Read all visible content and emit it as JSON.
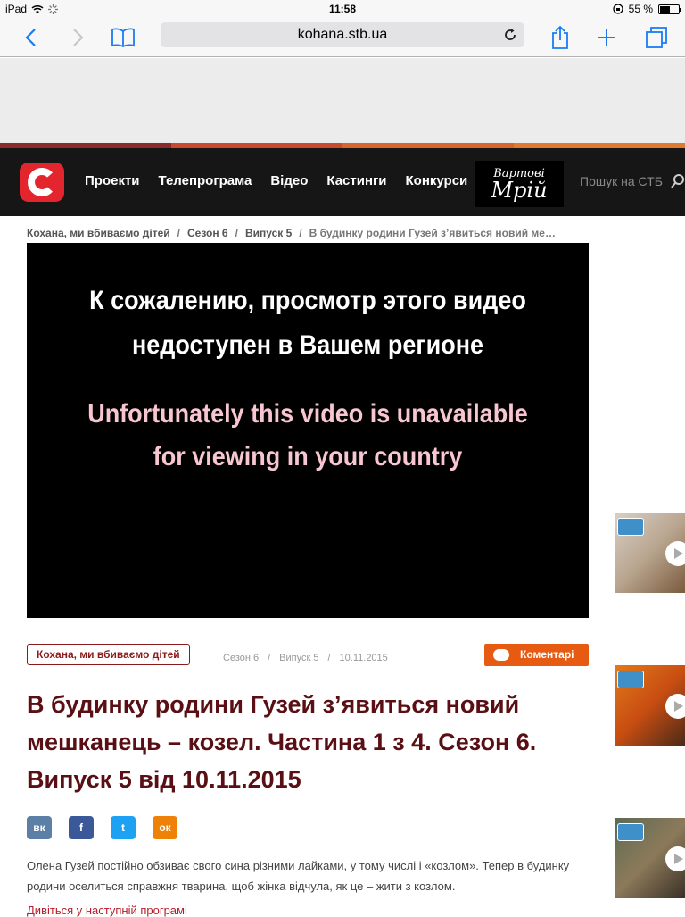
{
  "status_bar": {
    "device": "iPad",
    "time": "11:58",
    "battery": "55 %",
    "battery_level": 0.55
  },
  "browser": {
    "url": "kohana.stb.ua"
  },
  "site_nav": {
    "items": [
      "Проекти",
      "Телепрограма",
      "Відео",
      "Кастинги",
      "Конкурси"
    ],
    "promo_line1": "Вартові",
    "promo_line2": "Мрій",
    "search_placeholder": "Пошук на СТБ"
  },
  "breadcrumb": {
    "items": [
      "Кохана, ми вбиваємо дітей",
      "Сезон 6",
      "Випуск 5"
    ],
    "current": "В будинку родини Гузей з’явиться новий ме…"
  },
  "video": {
    "message_ru_line1": "К сожалению, просмотр этого видео",
    "message_ru_line2": "недоступен в Вашем регионе",
    "message_en_line1": "Unfortunately this video is unavailable",
    "message_en_line2": "for viewing in your country"
  },
  "meta": {
    "show_tag": "Кохана, ми вбиваємо дітей",
    "season": "Сезон 6",
    "episode": "Випуск 5",
    "date": "10.11.2015",
    "comments_label": "Коментарі"
  },
  "headline": "В будинку родини Гузей з’явиться новий мешканець – козел. Частина 1 з 4. Сезон 6. Випуск 5 від 10.11.2015",
  "share": {
    "vk": "вк",
    "facebook": "f",
    "twitter": "t",
    "odnoklassniki": "ок"
  },
  "body": {
    "text": "Олена Гузей постійно обзиває свого сина різними лайками, у тому числі і «козлом». Тепер в будинку родини оселиться справжня тварина, щоб жінка відчула, як це – жити з козлом.",
    "more_link": "Дивіться у наступній програмі"
  },
  "colors": {
    "brand_red": "#e3262d",
    "headline": "#5a0f14",
    "comments_orange": "#e65a12",
    "nav_bg": "#161616"
  }
}
